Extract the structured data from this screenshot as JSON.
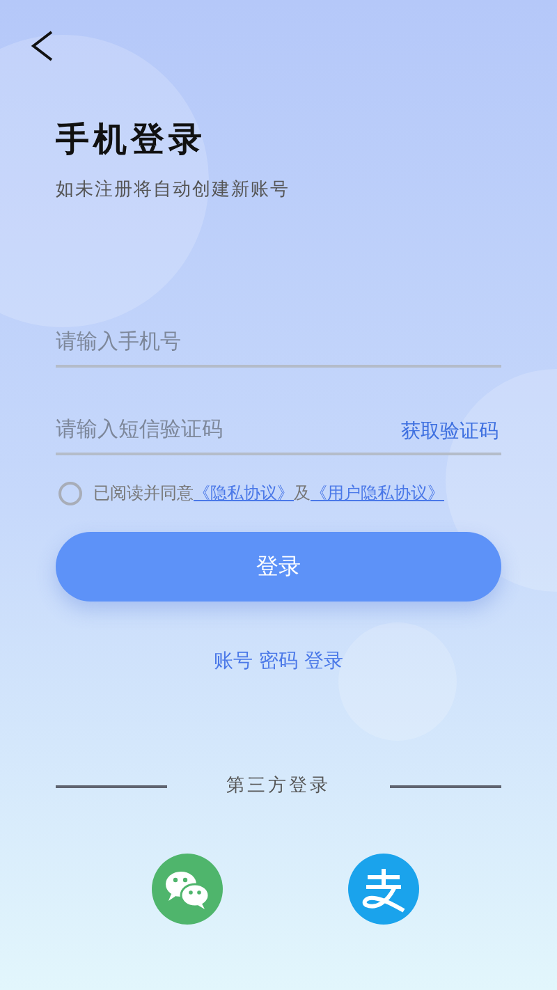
{
  "title": "手机登录",
  "subtitle": "如未注册将自动创建新账号",
  "phone_field": {
    "placeholder": "请输入手机号"
  },
  "code_field": {
    "placeholder": "请输入短信验证码"
  },
  "get_code_button": "获取验证码",
  "agreement": {
    "checked": false,
    "prefix": "已阅读并同意",
    "links": [
      "《隐私协议》",
      "《用户隐私协议》"
    ],
    "joiner": "及"
  },
  "login_button": "登录",
  "alt_login": "账号 密码 登录",
  "third_party": {
    "label": "第三方登录",
    "providers": [
      {
        "kind": "wechat"
      },
      {
        "kind": "alipay"
      }
    ]
  }
}
